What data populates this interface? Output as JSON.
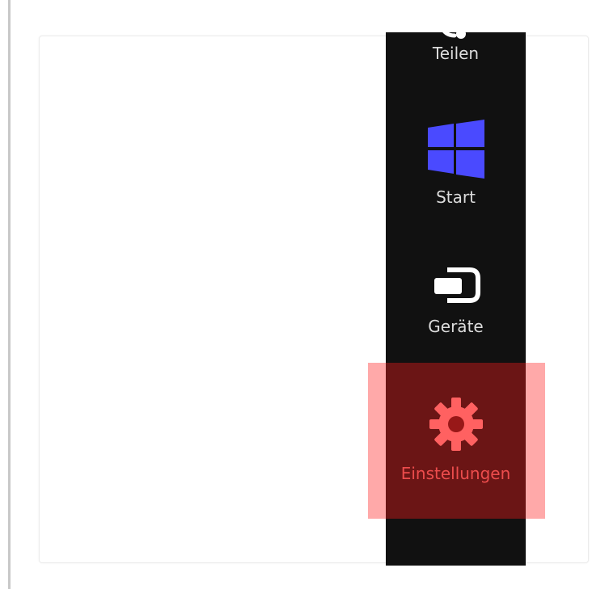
{
  "charms_bar": {
    "items": [
      {
        "label": "Teilen",
        "icon": "share-icon"
      },
      {
        "label": "Start",
        "icon": "windows-start-icon"
      },
      {
        "label": "Geräte",
        "icon": "devices-icon"
      },
      {
        "label": "Einstellungen",
        "icon": "gear-icon"
      }
    ],
    "highlighted_item": "Einstellungen"
  },
  "colors": {
    "charms_background": "#111111",
    "start_logo": "#4a4aff",
    "highlight_overlay": "#ff1e1e",
    "settings_icon": "#ff8c8c"
  }
}
